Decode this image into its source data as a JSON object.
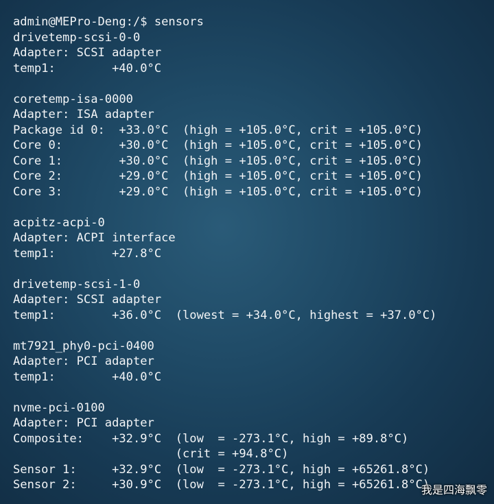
{
  "terminal": {
    "prompt_line": "admin@MEPro-Deng:/$ sensors",
    "lines": [
      "drivetemp-scsi-0-0",
      "Adapter: SCSI adapter",
      "temp1:        +40.0°C",
      "",
      "coretemp-isa-0000",
      "Adapter: ISA adapter",
      "Package id 0:  +33.0°C  (high = +105.0°C, crit = +105.0°C)",
      "Core 0:        +30.0°C  (high = +105.0°C, crit = +105.0°C)",
      "Core 1:        +30.0°C  (high = +105.0°C, crit = +105.0°C)",
      "Core 2:        +29.0°C  (high = +105.0°C, crit = +105.0°C)",
      "Core 3:        +29.0°C  (high = +105.0°C, crit = +105.0°C)",
      "",
      "acpitz-acpi-0",
      "Adapter: ACPI interface",
      "temp1:        +27.8°C",
      "",
      "drivetemp-scsi-1-0",
      "Adapter: SCSI adapter",
      "temp1:        +36.0°C  (lowest = +34.0°C, highest = +37.0°C)",
      "",
      "mt7921_phy0-pci-0400",
      "Adapter: PCI adapter",
      "temp1:        +40.0°C",
      "",
      "nvme-pci-0100",
      "Adapter: PCI adapter",
      "Composite:    +32.9°C  (low  = -273.1°C, high = +89.8°C)",
      "                       (crit = +94.8°C)",
      "Sensor 1:     +32.9°C  (low  = -273.1°C, high = +65261.8°C)",
      "Sensor 2:     +30.9°C  (low  = -273.1°C, high = +65261.8°C)"
    ]
  },
  "watermark": "我是四海飘零"
}
